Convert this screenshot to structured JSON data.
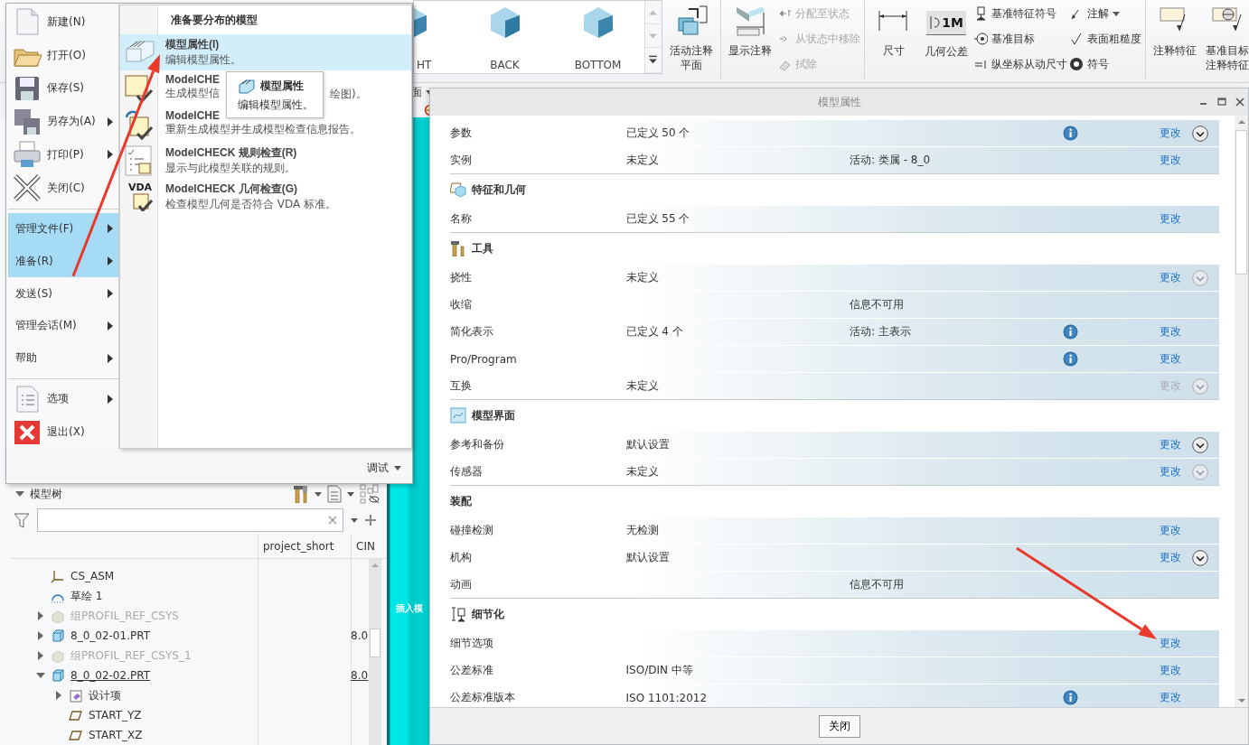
{
  "ribbon": {
    "gallery": [
      {
        "label": "HT",
        "cut": true
      },
      {
        "label": "BACK",
        "cut": false
      },
      {
        "label": "BOTTOM",
        "cut": false
      }
    ],
    "groups": [
      {
        "items": [
          {
            "kind": "large",
            "label": "活动注释平面"
          }
        ]
      },
      {
        "items": [
          {
            "kind": "large",
            "label": "显示注释"
          },
          {
            "kind": "stack",
            "items": [
              {
                "label": "分配至状态",
                "disabled": true,
                "dropdown": false
              },
              {
                "label": "从状态中移除",
                "disabled": true,
                "dropdown": false
              },
              {
                "label": "拭除",
                "disabled": true,
                "dropdown": false
              }
            ]
          }
        ]
      },
      {
        "items": [
          {
            "kind": "large",
            "label": "尺寸"
          },
          {
            "kind": "large",
            "label": "几何公差",
            "icon_text": "1M"
          },
          {
            "kind": "stack",
            "items": [
              {
                "label": "基准特征符号",
                "disabled": false,
                "dropdown": false
              },
              {
                "label": "基准目标",
                "disabled": false,
                "dropdown": false
              },
              {
                "label": "纵坐标从动尺寸",
                "disabled": false,
                "dropdown": false
              }
            ]
          },
          {
            "kind": "stack",
            "items": [
              {
                "label": "注解",
                "disabled": false,
                "dropdown": true
              },
              {
                "label": "表面粗糙度",
                "disabled": false,
                "dropdown": false
              },
              {
                "label": "符号",
                "disabled": false,
                "dropdown": false
              }
            ]
          }
        ]
      },
      {
        "items": [
          {
            "kind": "large",
            "label": "注释特征"
          },
          {
            "kind": "large",
            "label": "基准目标注释特征"
          }
        ]
      }
    ]
  },
  "view_toolbar": {
    "label": "面"
  },
  "file_menu": {
    "items": [
      {
        "kind": "icon-item",
        "label": "新建(N)",
        "submenu": false,
        "highlighted": false
      },
      {
        "kind": "icon-item",
        "label": "打开(O)",
        "submenu": false,
        "highlighted": false
      },
      {
        "kind": "icon-item",
        "label": "保存(S)",
        "submenu": false,
        "highlighted": false
      },
      {
        "kind": "icon-item",
        "label": "另存为(A)",
        "submenu": true,
        "highlighted": false
      },
      {
        "kind": "icon-item",
        "label": "打印(P)",
        "submenu": true,
        "highlighted": false
      },
      {
        "kind": "icon-item",
        "label": "关闭(C)",
        "submenu": false,
        "highlighted": false
      },
      {
        "kind": "separator"
      },
      {
        "kind": "text-item",
        "label": "管理文件(F)",
        "submenu": true,
        "highlighted": true
      },
      {
        "kind": "text-item",
        "label": "准备(R)",
        "submenu": true,
        "highlighted": true
      },
      {
        "kind": "text-item",
        "label": "发送(S)",
        "submenu": true,
        "highlighted": false
      },
      {
        "kind": "text-item",
        "label": "管理会话(M)",
        "submenu": true,
        "highlighted": false
      },
      {
        "kind": "text-item",
        "label": "帮助",
        "submenu": true,
        "highlighted": false
      },
      {
        "kind": "separator"
      },
      {
        "kind": "icon-item",
        "label": "选项",
        "submenu": true,
        "highlighted": false
      },
      {
        "kind": "icon-item",
        "label": "退出(X)",
        "submenu": false,
        "highlighted": false
      }
    ],
    "footer": "调试"
  },
  "prepare_menu": {
    "title": "准备要分布的模型",
    "items": [
      {
        "title": "模型属性(I)",
        "description": "编辑模型属性。",
        "highlighted": true
      },
      {
        "title": "ModelCHE",
        "description": "生成模型信",
        "description_tail": "绘图)。",
        "highlighted": false
      },
      {
        "title": "ModelCHE",
        "description": "重新生成模型并生成模型检查信息报告。",
        "highlighted": false
      },
      {
        "title": "ModelCHECK 规则检查(R)",
        "description": "显示与此模型关联的规则。",
        "highlighted": false
      },
      {
        "title": "ModelCHECK 几何检查(G)",
        "description": "检查模型几何是否符合 VDA 标准。",
        "highlighted": false,
        "badge": "VDA"
      }
    ]
  },
  "tooltip": {
    "title": "模型属性",
    "text": "编辑模型属性。"
  },
  "model_tree": {
    "title": "模型树",
    "expanded": true,
    "columns": [
      "project_short",
      "CIN"
    ],
    "nodes": [
      {
        "kind": "csys",
        "label": "CS_ASM",
        "disabled": false,
        "active": false
      },
      {
        "kind": "sketch",
        "label": "草绘 1",
        "disabled": false,
        "active": false
      },
      {
        "kind": "group",
        "label": "组PROFIL_REF_CSYS",
        "disabled": true,
        "active": false,
        "expanded": false
      },
      {
        "kind": "part",
        "label": "8_0_02-01.PRT",
        "disabled": false,
        "active": false,
        "expanded": false,
        "cin": "8.0"
      },
      {
        "kind": "group",
        "label": "组PROFIL_REF_CSYS_1",
        "disabled": true,
        "active": false,
        "expanded": false
      },
      {
        "kind": "part",
        "label": "8_0_02-02.PRT",
        "disabled": false,
        "active": true,
        "expanded": true,
        "cin": "8.0",
        "children": [
          {
            "kind": "folder",
            "label": "设计项",
            "disabled": false,
            "active": false,
            "expanded": false
          },
          {
            "kind": "plane",
            "label": "START_YZ",
            "disabled": false,
            "active": false
          },
          {
            "kind": "plane",
            "label": "START_XZ",
            "disabled": false,
            "active": false
          }
        ]
      }
    ]
  },
  "graphics": {
    "mode_label": "插入模"
  },
  "properties": {
    "title": "模型属性",
    "close_button": "关闭",
    "sections": [
      {
        "kind": "plain",
        "rows": [
          {
            "label": "参数",
            "value": "已定义 50 个",
            "info": true,
            "link": "更改",
            "link_disabled": false,
            "expander": true,
            "expander_disabled": false
          },
          {
            "label": "实例",
            "value": "未定义",
            "detail": "活动: 类属 - 8_0",
            "info": false,
            "link": "更改",
            "link_disabled": false,
            "expander": false
          }
        ]
      },
      {
        "kind": "features",
        "title": "特征和几何",
        "rows": [
          {
            "label": "名称",
            "value": "已定义 55 个",
            "info": false,
            "link": "更改",
            "link_disabled": false,
            "expander": false
          }
        ]
      },
      {
        "kind": "tools",
        "title": "工具",
        "rows": [
          {
            "label": "挠性",
            "value": "未定义",
            "info": false,
            "link": "更改",
            "link_disabled": false,
            "expander": true,
            "expander_disabled": true
          },
          {
            "label": "收缩",
            "detail": "信息不可用",
            "info": false,
            "expander": false
          },
          {
            "label": "简化表示",
            "value": "已定义 4 个",
            "detail": "活动: 主表示",
            "info": true,
            "link": "更改",
            "link_disabled": false,
            "expander": false
          },
          {
            "label": "Pro/Program",
            "info": true,
            "link": "更改",
            "link_disabled": false,
            "expander": false
          },
          {
            "label": "互换",
            "value": "未定义",
            "info": false,
            "link": "更改",
            "link_disabled": true,
            "expander": true,
            "expander_disabled": true
          }
        ]
      },
      {
        "kind": "interface",
        "title": "模型界面",
        "rows": [
          {
            "label": "参考和备份",
            "value": "默认设置",
            "info": false,
            "link": "更改",
            "link_disabled": false,
            "expander": true,
            "expander_disabled": false
          },
          {
            "label": "传感器",
            "value": "未定义",
            "info": false,
            "link": "更改",
            "link_disabled": false,
            "expander": true,
            "expander_disabled": true
          }
        ]
      },
      {
        "kind": "plain",
        "title": "装配",
        "rows": [
          {
            "label": "碰撞检测",
            "value": "无检测",
            "info": false,
            "link": "更改",
            "link_disabled": false,
            "expander": false
          },
          {
            "label": "机构",
            "value": "默认设置",
            "info": false,
            "link": "更改",
            "link_disabled": false,
            "expander": true,
            "expander_disabled": false
          },
          {
            "label": "动画",
            "detail": "信息不可用",
            "info": false,
            "expander": false
          }
        ]
      },
      {
        "kind": "detail",
        "title": "细节化",
        "rows": [
          {
            "label": "细节选项",
            "info": false,
            "link": "更改",
            "link_disabled": false,
            "expander": false
          },
          {
            "label": "公差标准",
            "value": "ISO/DIN 中等",
            "info": false,
            "link": "更改",
            "link_disabled": false,
            "expander": false
          },
          {
            "label": "公差标准版本",
            "value": "ISO 1101:2012",
            "info": true,
            "link": "更改",
            "link_disabled": false,
            "expander": false
          }
        ]
      }
    ]
  },
  "annotations": [
    {
      "kind": "arrow"
    },
    {
      "kind": "arrow"
    }
  ]
}
